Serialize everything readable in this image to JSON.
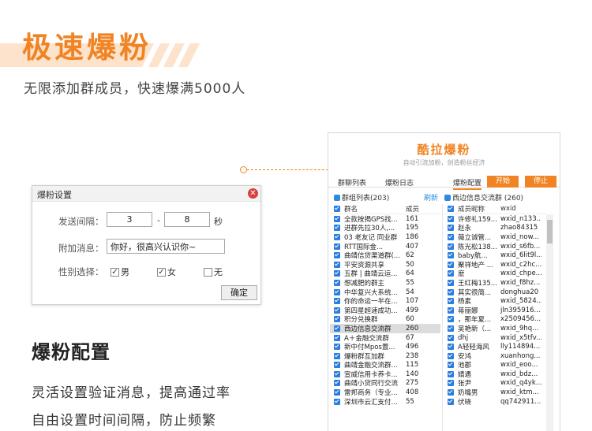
{
  "hero": {
    "title": "极速爆粉",
    "subtitle": "无限添加群成员，快速爆满5000人"
  },
  "dialog": {
    "title": "爆粉设置",
    "interval_label": "发送间隔：",
    "interval_min": "3",
    "dash": "-",
    "interval_max": "8",
    "seconds": "秒",
    "msg_label": "附加消息：",
    "msg_value": "你好，很高兴认识你~",
    "gender_label": "性别选择：",
    "male": "男",
    "female": "女",
    "none": "无",
    "male_checked": true,
    "female_checked": true,
    "none_checked": false,
    "confirm": "确定"
  },
  "feature": {
    "title": "爆粉配置",
    "line1": "灵活设置验证消息，提高通过率",
    "line2": "自由设置时间间隔，防止频繁"
  },
  "app": {
    "title": "酷拉爆粉",
    "subtitle": "自动引流加粉，创造粉丝经济",
    "tabs": [
      "群聊列表",
      "爆粉日志",
      "爆粉配置"
    ],
    "start": "开始",
    "stop": "停止",
    "group_list_title": "群组列表(203)",
    "refresh": "刷新",
    "member_group_title": "西边信息交流群  (260)",
    "group_headers": {
      "name": "群名",
      "count": "成员"
    },
    "member_headers": {
      "nick": "成员昵称",
      "wxid": "wxid"
    },
    "groups": [
      {
        "name": "全款按揭GPS找...",
        "count": "161"
      },
      {
        "name": "进群先拉30人,...",
        "count": "195"
      },
      {
        "name": "03 老友记 同业群",
        "count": "186"
      },
      {
        "name": "    RTT国际金...",
        "count": "407"
      },
      {
        "name": "曲靖信贷渠道群(...",
        "count": "62"
      },
      {
        "name": "平安资源共享",
        "count": "50"
      },
      {
        "name": "五群 | 曲靖云运...",
        "count": "64"
      },
      {
        "name": "想减肥的群主",
        "count": "55"
      },
      {
        "name": "中华复兴大系统...",
        "count": "54"
      },
      {
        "name": "你的命运一半在...",
        "count": "107"
      },
      {
        "name": "第四星超速成功...",
        "count": "499"
      },
      {
        "name": "积分兑换群",
        "count": "60"
      },
      {
        "name": "西边信息交流群",
        "count": "260",
        "selected": true
      },
      {
        "name": "A＋金融交流群",
        "count": "67"
      },
      {
        "name": "新中付Mpos置...",
        "count": "496"
      },
      {
        "name": "爆粉群互加群",
        "count": "238"
      },
      {
        "name": "曲靖金融交流群...",
        "count": "115"
      },
      {
        "name": "宣威信用卡养卡...",
        "count": "140"
      },
      {
        "name": "曲靖小贷同行交流",
        "count": "275"
      },
      {
        "name": "雷邦商务（专业...",
        "count": "408"
      },
      {
        "name": "深圳市云汇支付...",
        "count": "55"
      }
    ],
    "members": [
      {
        "nick": "许修礼159...",
        "wxid": "wxid_n133..."
      },
      {
        "nick": "赵永",
        "wxid": "zhao84315"
      },
      {
        "nick": "薇立诚管...",
        "wxid": "wxid_now..."
      },
      {
        "nick": "陈光松138...",
        "wxid": "wxid_s6fb..."
      },
      {
        "nick": "    baby航...",
        "wxid": "wxid_6lit9l..."
      },
      {
        "nick": "聚祥地产 ...",
        "wxid": "wxid_c2hc..."
      },
      {
        "nick": "麽",
        "wxid": "wxid_chpe..."
      },
      {
        "nick": "王红梅135...",
        "wxid": "wxid_f8hz..."
      },
      {
        "nick": "其实很简...",
        "wxid": "donghua20"
      },
      {
        "nick": "杨素",
        "wxid": "wxid_5824..."
      },
      {
        "nick": "蒋丽娜",
        "wxid": "jln395916..."
      },
      {
        "nick": "，那年夏...",
        "wxid": "x2509456..."
      },
      {
        "nick": "吴艳新（...",
        "wxid": "wxid_9hq..."
      },
      {
        "nick": "dhj",
        "wxid": "wxid_x5tfv..."
      },
      {
        "nick": "A轻轻海风",
        "wxid": "lly114894..."
      },
      {
        "nick": "安鸿",
        "wxid": "xuanhong..."
      },
      {
        "nick": "池郡",
        "wxid": "wxid_eoo..."
      },
      {
        "nick": "婧遇",
        "wxid": "wxid_bdz..."
      },
      {
        "nick": "张尹",
        "wxid": "wxid_q4yk..."
      },
      {
        "nick": "奶嘴男",
        "wxid": "wxid_ktm..."
      },
      {
        "nick": "伏晓",
        "wxid": "qq742911..."
      }
    ]
  },
  "colors": {
    "accent": "#f08424",
    "check": "#2b7de0",
    "close": "#d9403a"
  }
}
